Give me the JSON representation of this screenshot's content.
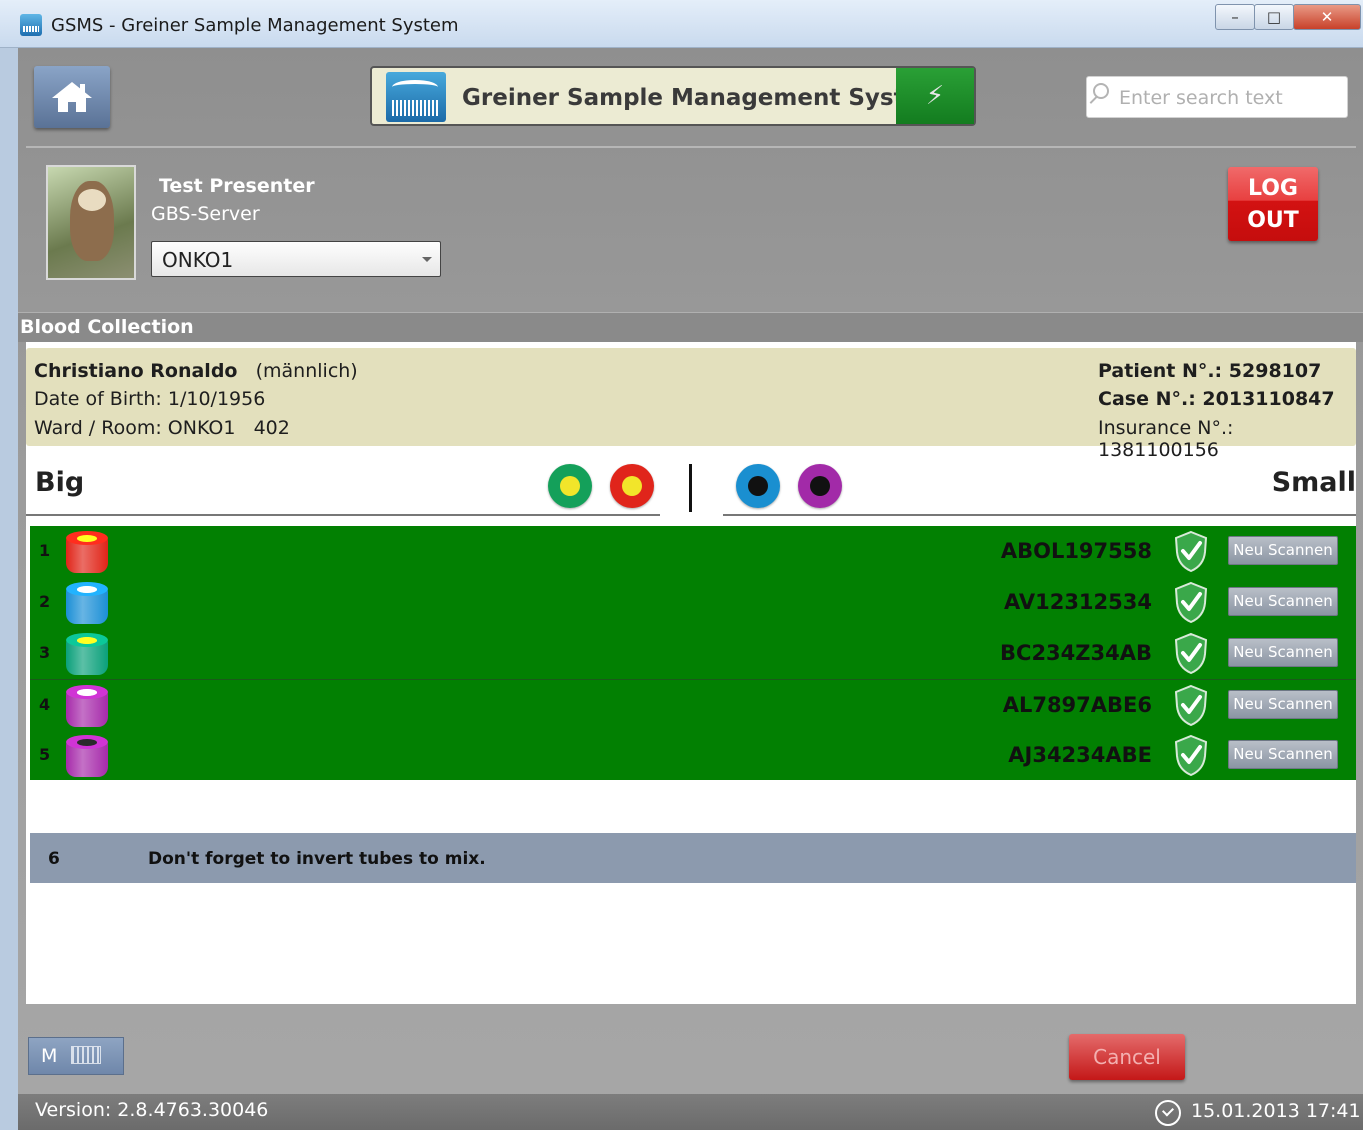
{
  "window": {
    "title": "GSMS - Greiner Sample Management System",
    "controls": [
      "minimize",
      "maximize",
      "close"
    ]
  },
  "header": {
    "banner_title": "Greiner Sample Management System",
    "search_placeholder": "Enter search text"
  },
  "user": {
    "name": "Test Presenter",
    "server": "GBS-Server",
    "ward_selected": "ONKO1",
    "logout_line1": "LOG",
    "logout_line2": "OUT"
  },
  "section": {
    "title": "Blood Collection"
  },
  "patient": {
    "name": "Christiano Ronaldo",
    "gender": "(männlich)",
    "dob_label": "Date of Birth:",
    "dob": "1/10/1956",
    "ward_label": "Ward / Room:",
    "ward": "ONKO1",
    "room": "402",
    "patient_no_label": "Patient N°.:",
    "patient_no": "5298107",
    "case_no_label": "Case N°.:",
    "case_no": "2013110847",
    "insurance_label": "Insurance N°.:",
    "insurance_no": "1381100156"
  },
  "tube_header": {
    "big_label": "Big",
    "small_label": "Small",
    "big_caps": [
      {
        "ring": "#14a05a",
        "center": "#f2e52a"
      },
      {
        "ring": "#e0251b",
        "center": "#f2e52a"
      }
    ],
    "small_caps": [
      {
        "ring": "#1a8fd0",
        "center": "#111111"
      },
      {
        "ring": "#a22aa8",
        "center": "#111111"
      }
    ]
  },
  "tubes": [
    {
      "num": "1",
      "barcode": "ABOL197558",
      "cap_color": "#e02418",
      "cap_inner": "#f2d21a",
      "status": "verified",
      "action": "Neu Scannen"
    },
    {
      "num": "2",
      "barcode": "AV12312534",
      "cap_color": "#1b8fd6",
      "cap_inner": "#e8e8e8",
      "status": "verified",
      "action": "Neu Scannen"
    },
    {
      "num": "3",
      "barcode": "BC234Z34AB",
      "cap_color": "#0aa07a",
      "cap_inner": "#f2d21a",
      "status": "verified",
      "action": "Neu Scannen"
    },
    {
      "num": "4",
      "barcode": "AL7897ABE6",
      "cap_color": "#a62aaa",
      "cap_inner": "#e8e8e8",
      "status": "verified",
      "action": "Neu Scannen"
    },
    {
      "num": "5",
      "barcode": "AJ34234ABE",
      "cap_color": "#a62aaa",
      "cap_inner": "#222222",
      "status": "verified",
      "action": "Neu Scannen"
    }
  ],
  "notice": {
    "num": "6",
    "text": "Don't forget to invert tubes to mix."
  },
  "footer": {
    "keyboard_label": "M",
    "cancel_label": "Cancel",
    "version": "Version: 2.8.4763.30046",
    "datetime": "15.01.2013 17:41"
  },
  "colors": {
    "row_green": "#028002",
    "notice_bg": "#8c9aae",
    "patient_bg": "#e3e0bd",
    "logout_red": "#d31212"
  }
}
